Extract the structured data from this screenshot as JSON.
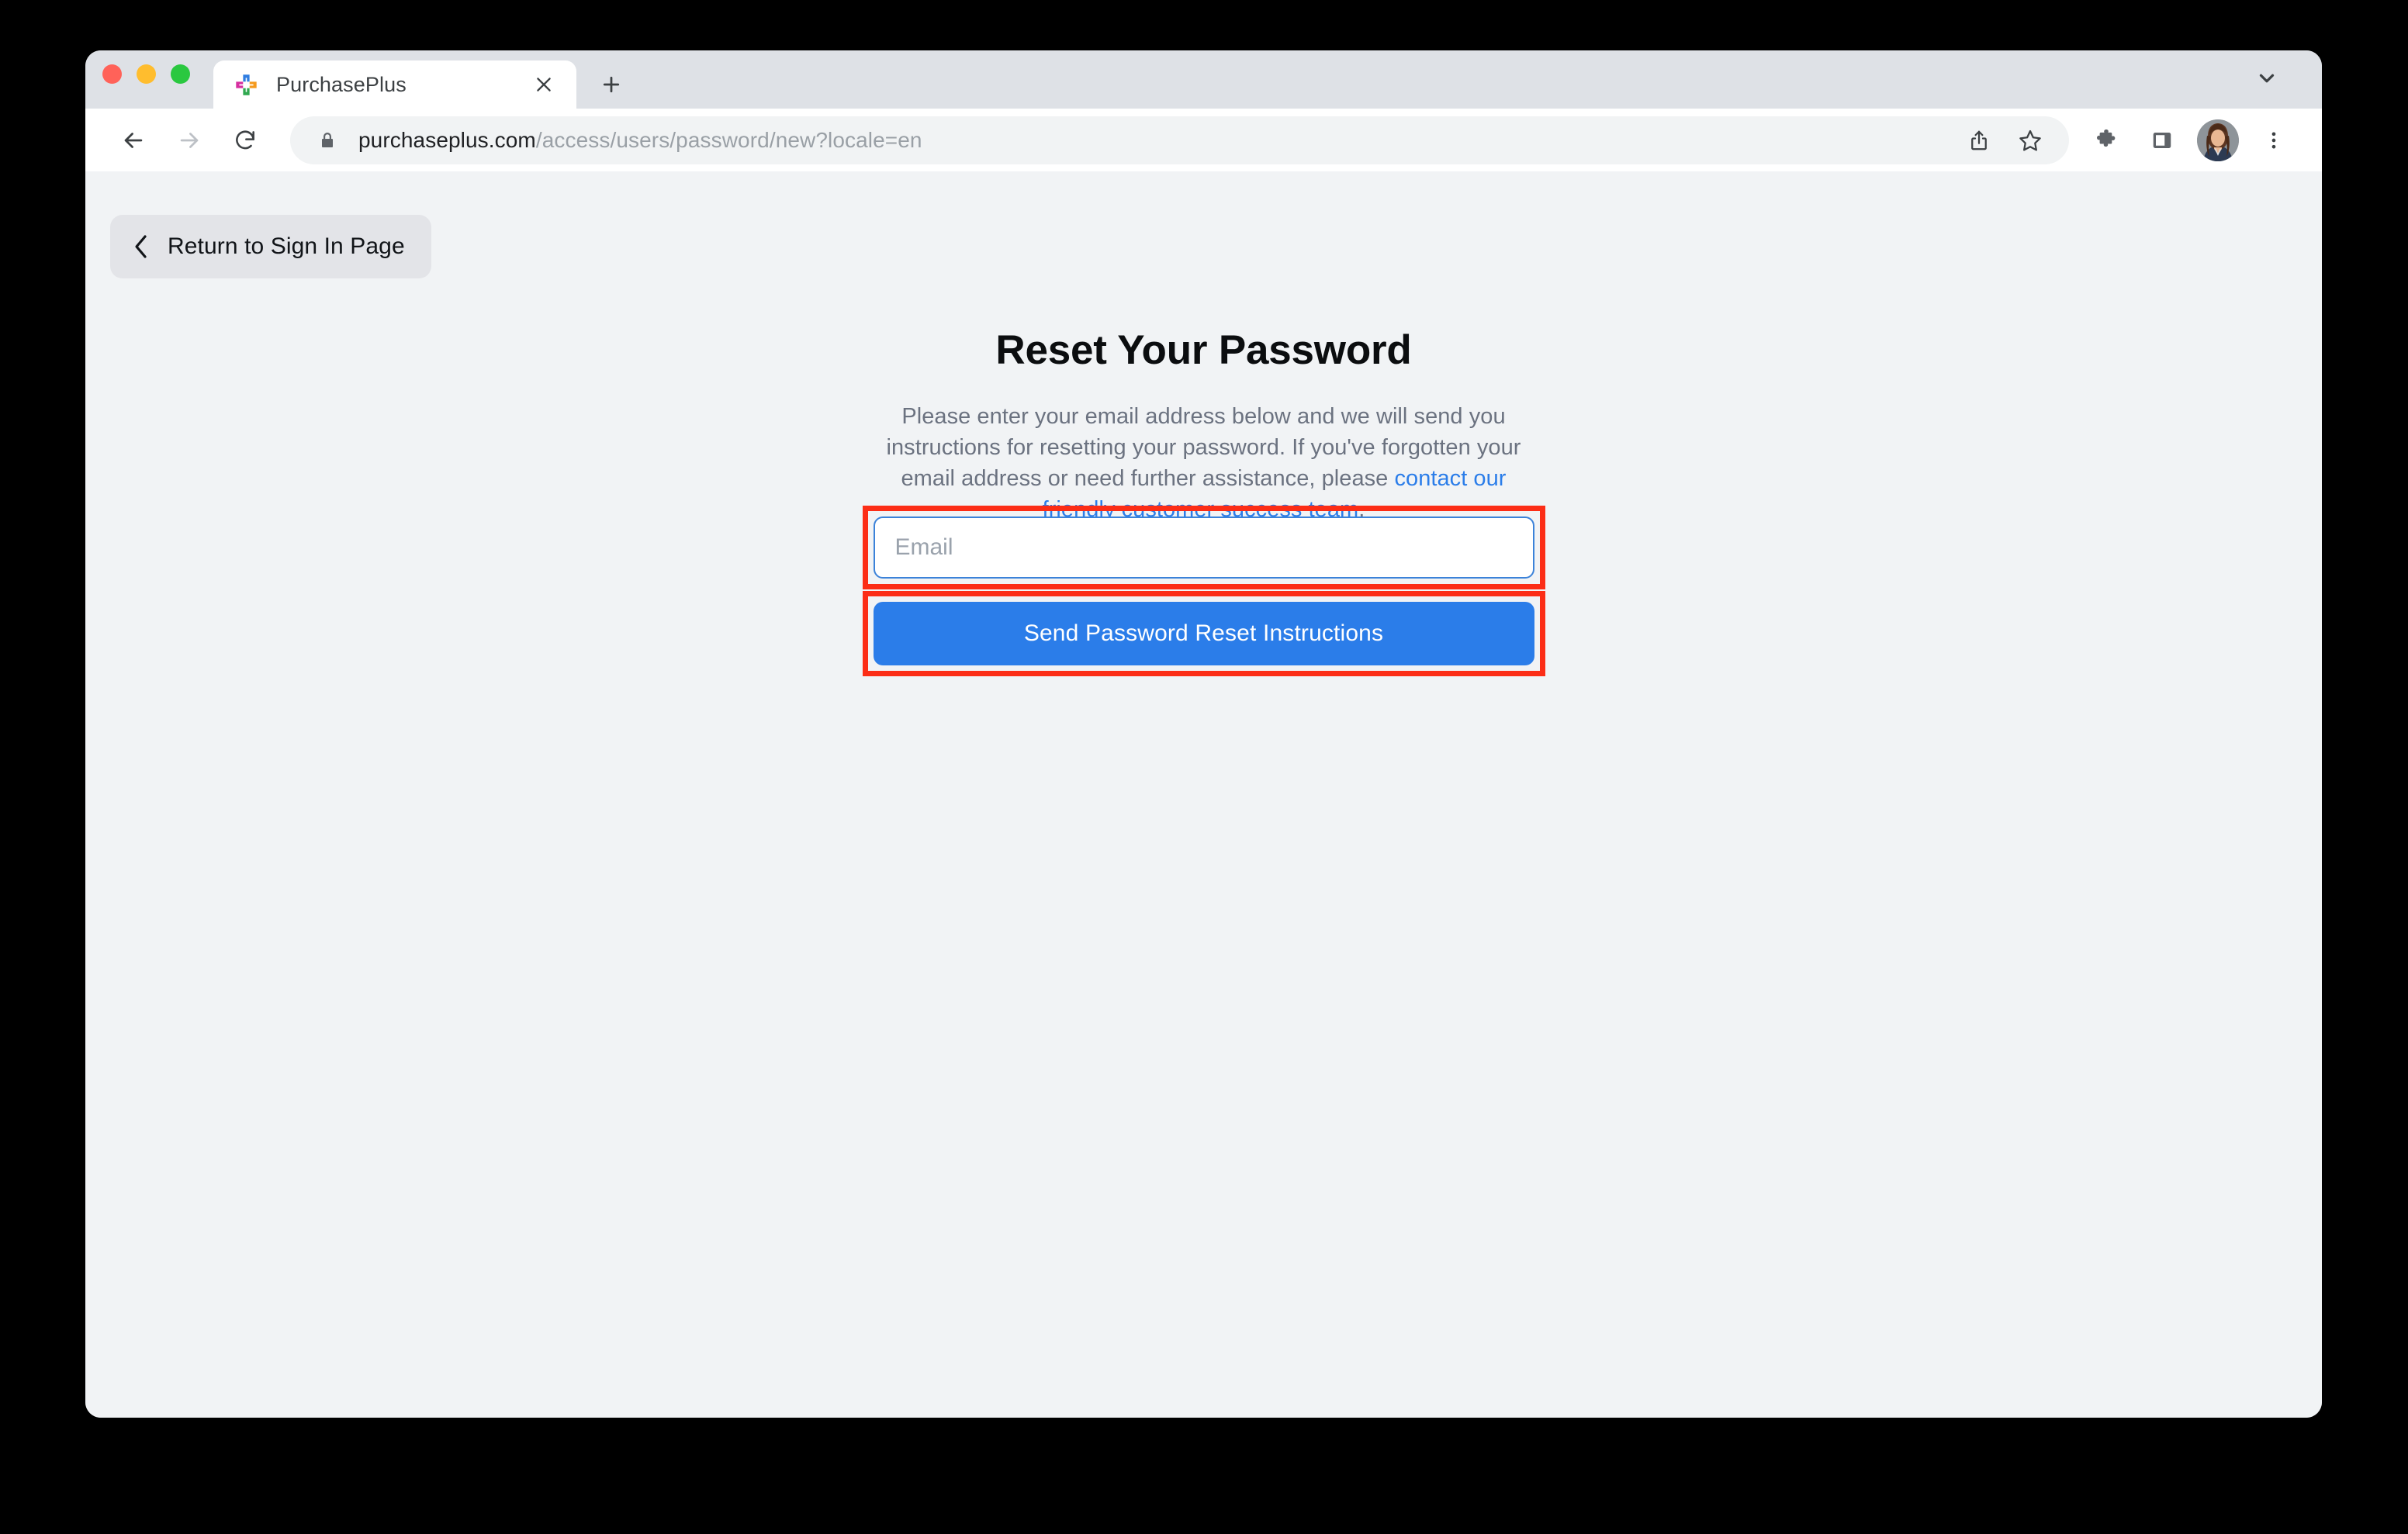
{
  "browser": {
    "traffic_lights": [
      "close",
      "minimize",
      "maximize"
    ],
    "tab": {
      "title": "PurchasePlus",
      "favicon": "purchaseplus-cross-icon",
      "close_label": "×"
    },
    "new_tab_label": "+",
    "tab_search_icon": "chevron-down-icon",
    "toolbar": {
      "back_icon": "arrow-left-icon",
      "forward_icon": "arrow-right-icon",
      "reload_icon": "reload-icon",
      "lock_icon": "lock-icon",
      "url_domain": "purchaseplus.com",
      "url_path": "/access/users/password/new?locale=en",
      "share_icon": "share-icon",
      "bookmark_icon": "star-icon",
      "extensions_icon": "puzzle-icon",
      "side_panel_icon": "side-panel-icon",
      "avatar_icon": "user-avatar",
      "menu_icon": "three-dot-menu-icon"
    }
  },
  "page": {
    "return_button": {
      "label": "Return to Sign In Page",
      "icon": "chevron-left-icon"
    },
    "title": "Reset Your Password",
    "description_part1": "Please enter your email address below and we will send you instructions for resetting your password. If you've forgotten your email address or need further assistance, please ",
    "description_link": "contact our friendly customer success team",
    "description_part2": ".",
    "email_placeholder": "Email",
    "email_value": "",
    "submit_label": "Send Password Reset Instructions"
  },
  "colors": {
    "accent_blue": "#2b7de9",
    "link_blue": "#2b7de9",
    "annotation_red": "#fc2d16",
    "page_background": "#f1f3f5",
    "tab_strip": "#dee1e6",
    "omnibox": "#f1f3f4",
    "muted_text": "#6b7280"
  }
}
